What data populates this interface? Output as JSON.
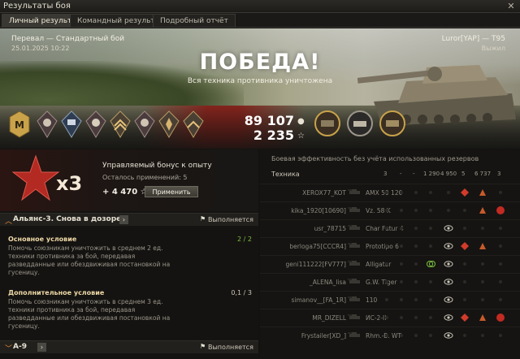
{
  "window": {
    "title": "Результаты боя"
  },
  "tabs": [
    "Личный результат",
    "Командный результат",
    "Подробный отчёт"
  ],
  "hero": {
    "map": "Перевал — Стандартный бой",
    "date": "25.01.2025 10:22",
    "player": "Luror[YAP] — T95",
    "player_status": "Выжил",
    "result": "ПОБЕДА!",
    "subtitle": "Вся техника противника уничтожена",
    "credits": "89 107",
    "xp": "2 235",
    "medals": [
      "rank-m-icon",
      "medal-1-icon",
      "medal-2-icon",
      "medal-3-icon",
      "medal-4-icon",
      "medal-5-icon",
      "medal-6-icon",
      "medal-7-icon"
    ],
    "achievements": [
      "achievement-1-icon",
      "achievement-2-icon",
      "achievement-3-icon"
    ]
  },
  "bonus": {
    "multiplier": "x3",
    "title": "Управляемый бонус к опыту",
    "remaining": "Осталось применений: 5",
    "xp": "+ 4 470",
    "apply_label": "Применить"
  },
  "missions": [
    {
      "title": "Альянс-3. Снова в дозоре",
      "status": "Выполняется",
      "conditions": [
        {
          "title": "Основное условие",
          "progress": "2 / 2",
          "done": true,
          "desc": "Помочь союзникам уничтожить в среднем 2 ед. техники противника за бой, передавая разведданные или обездвиживая постановкой на гусеницу."
        },
        {
          "title": "Дополнительное условие",
          "progress": "0,1 / 3",
          "done": false,
          "desc": "Помочь союзникам уничтожить в среднем 3 ед. техники противника за бой, передавая разведданные или обездвиживая постановкой на гусеницу."
        }
      ]
    },
    {
      "title": "А-9",
      "status": "Выполняется",
      "conditions": []
    }
  ],
  "efficiency": {
    "title": "Боевая эффективность без учёта использованных резервов",
    "headers": {
      "vehicle": "Техника",
      "h1": "3",
      "h2": "-",
      "h3": "-",
      "h4": "1 290",
      "h5": "4 950",
      "h6": "5",
      "h7": "6 737",
      "h8": "3"
    },
    "rows": [
      {
        "player": "XEROX77_KOT",
        "tank": "AMX 50 120",
        "icons": [
          "",
          "",
          "",
          "",
          "",
          "dmg",
          "crit",
          ""
        ]
      },
      {
        "player": "kika_1920[10690]",
        "tank": "Vz. 58 K",
        "icons": [
          "",
          "",
          "",
          "",
          "",
          "",
          "crit",
          "kill"
        ]
      },
      {
        "player": "usr_78715",
        "tank": "Char Futur 4",
        "icons": [
          "",
          "",
          "",
          "",
          "spot",
          "",
          "",
          ""
        ]
      },
      {
        "player": "berloga75[CCCR4]",
        "tank": "Prototipo 6",
        "icons": [
          "",
          "",
          "",
          "",
          "spot",
          "dmg",
          "crit",
          ""
        ]
      },
      {
        "player": "geni111222[FV777]",
        "tank": "Alligator",
        "icons": [
          "",
          "",
          "",
          "assist",
          "spot",
          "",
          "",
          ""
        ]
      },
      {
        "player": "_ALENA_lisa",
        "tank": "G.W. Tiger",
        "icons": [
          "",
          "",
          "",
          "",
          "spot",
          "",
          "",
          ""
        ]
      },
      {
        "player": "simanov__[FA_1R]",
        "tank": "110",
        "icons": [
          "",
          "",
          "",
          "",
          "spot",
          "",
          "",
          ""
        ]
      },
      {
        "player": "MR_DIZELL",
        "tank": "ИС-2-II",
        "icons": [
          "",
          "",
          "",
          "",
          "spot",
          "dmg",
          "crit",
          "kill"
        ]
      },
      {
        "player": "Frystailer[XD_]",
        "tank": "Rhm.-B. WT",
        "icons": [
          "",
          "",
          "",
          "",
          "spot",
          "",
          "",
          ""
        ]
      }
    ]
  },
  "colors": {
    "accent_orange": "#e58a3a",
    "done_green": "#7fbf3f",
    "damage_red": "#d23a2a",
    "gold": "#c9a24a"
  }
}
